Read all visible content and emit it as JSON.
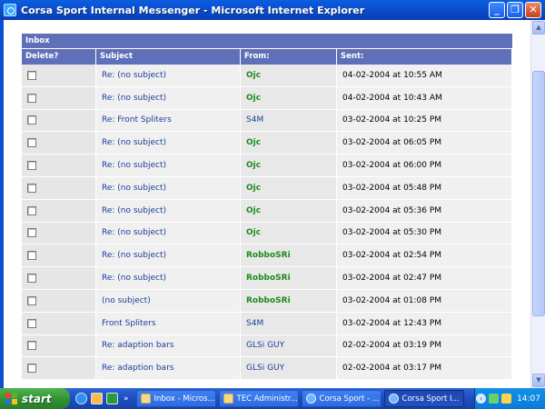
{
  "window": {
    "title": "Corsa Sport Internal Messenger - Microsoft Internet Explorer",
    "min_glyph": "_",
    "max_glyph": "❐",
    "close_glyph": "✕"
  },
  "inbox": {
    "title": "Inbox",
    "columns": [
      "Delete?",
      "Subject",
      "From:",
      "Sent:"
    ],
    "messages": [
      {
        "subject": "Re: (no subject)",
        "from": "Ojc",
        "sent": "04-02-2004 at 10:55 AM"
      },
      {
        "subject": "Re: (no subject)",
        "from": "Ojc",
        "sent": "04-02-2004 at 10:43 AM"
      },
      {
        "subject": "Re: Front Spliters",
        "from": "S4M",
        "sent": "03-02-2004 at 10:25 PM"
      },
      {
        "subject": "Re: (no subject)",
        "from": "Ojc",
        "sent": "03-02-2004 at 06:05 PM"
      },
      {
        "subject": "Re: (no subject)",
        "from": "Ojc",
        "sent": "03-02-2004 at 06:00 PM"
      },
      {
        "subject": "Re: (no subject)",
        "from": "Ojc",
        "sent": "03-02-2004 at 05:48 PM"
      },
      {
        "subject": "Re: (no subject)",
        "from": "Ojc",
        "sent": "03-02-2004 at 05:36 PM"
      },
      {
        "subject": "Re: (no subject)",
        "from": "Ojc",
        "sent": "03-02-2004 at 05:30 PM"
      },
      {
        "subject": "Re: (no subject)",
        "from": "RobboSRi",
        "sent": "03-02-2004 at 02:54 PM"
      },
      {
        "subject": "Re: (no subject)",
        "from": "RobboSRi",
        "sent": "03-02-2004 at 02:47 PM"
      },
      {
        "subject": "(no subject)",
        "from": "RobboSRi",
        "sent": "03-02-2004 at 01:08 PM"
      },
      {
        "subject": "Front Spliters",
        "from": "S4M",
        "sent": "03-02-2004 at 12:43 PM"
      },
      {
        "subject": "Re: adaption bars",
        "from": "GLSi GUY",
        "sent": "02-02-2004 at 03:19 PM"
      },
      {
        "subject": "Re: adaption bars",
        "from": "GLSi GUY",
        "sent": "02-02-2004 at 03:17 PM"
      }
    ],
    "from_colors": {
      "Ojc": "green",
      "RobboSRi": "green",
      "S4M": "blue",
      "GLSi GUY": "blue"
    }
  },
  "scrollbar": {
    "up_glyph": "▲",
    "down_glyph": "▼"
  },
  "taskbar": {
    "start_label": "start",
    "more_glyph": "»",
    "tasks": [
      {
        "label": "Inbox - Micros...",
        "icon": "folder",
        "active": false
      },
      {
        "label": "TEC Administr...",
        "icon": "folder",
        "active": false
      },
      {
        "label": "Corsa Sport - ...",
        "icon": "ie",
        "active": false
      },
      {
        "label": "Corsa Sport I...",
        "icon": "ie",
        "active": true
      }
    ],
    "tray_arrow_glyph": "‹",
    "clock": "14:07"
  }
}
